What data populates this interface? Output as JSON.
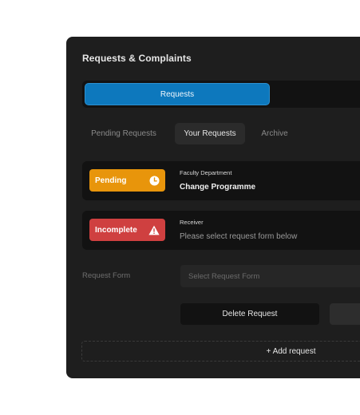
{
  "panel": {
    "title": "Requests & Complaints"
  },
  "segments": [
    {
      "label": "Requests",
      "active": true
    }
  ],
  "tabs": [
    {
      "label": "Pending Requests",
      "active": false
    },
    {
      "label": "Your Requests",
      "active": true
    },
    {
      "label": "Archive",
      "active": false
    }
  ],
  "cards": [
    {
      "status": "Pending",
      "status_icon": "clock-icon",
      "status_color": "#e8950b",
      "label": "Faculty Department",
      "value": "Change Programme"
    },
    {
      "status": "Incomplete",
      "status_icon": "warning-icon",
      "status_color": "#cf4040",
      "label": "Receiver",
      "value": "Please select request form below"
    }
  ],
  "form": {
    "label": "Request Form",
    "select_placeholder": "Select Request Form"
  },
  "actions": {
    "delete_label": "Delete Request",
    "add_label": "+ Add request"
  },
  "colors": {
    "accent": "#0d78bd",
    "panel_bg": "#1e1e1e"
  }
}
